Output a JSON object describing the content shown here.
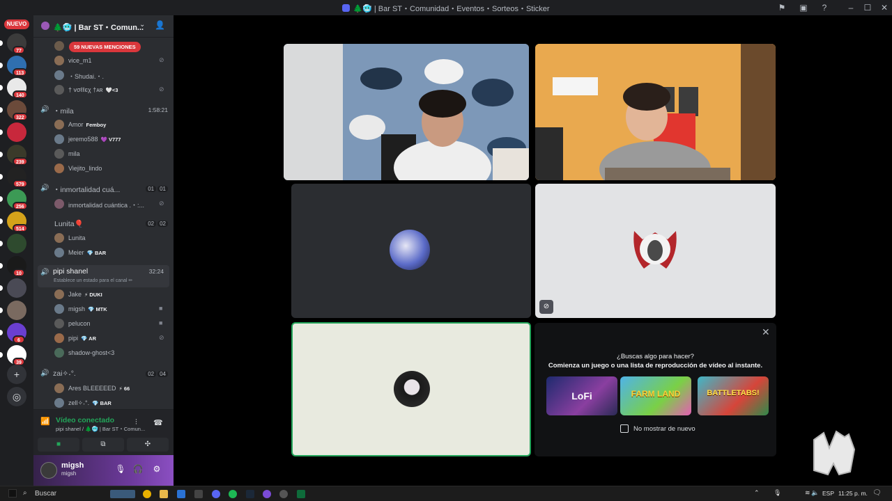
{
  "titlebar": {
    "title": "🌲🥶 | Bar ST・Comunidad・Eventos・Sorteos・Sticker"
  },
  "rail": {
    "new_label": "NUEVO",
    "servers": [
      {
        "badge": "77",
        "color": "#3b3b3b"
      },
      {
        "badge": "113",
        "color": "#2f6fb0"
      },
      {
        "badge": "140",
        "color": "#e9e9e9"
      },
      {
        "badge": "322",
        "color": "#6b4a3a"
      },
      {
        "badge": "",
        "color": "#c8283c"
      },
      {
        "badge": "239",
        "color": "#3a3a2a"
      },
      {
        "badge": "579",
        "color": "#222222"
      },
      {
        "badge": "256",
        "color": "#3c9a55"
      },
      {
        "badge": "514",
        "color": "#d4a21a"
      },
      {
        "badge": "",
        "color": "#2e4a2e"
      },
      {
        "badge": "10",
        "color": "#1a1a1a"
      },
      {
        "badge": "",
        "color": "#4a4a55"
      },
      {
        "badge": "",
        "color": "#7a6a60"
      },
      {
        "badge": "6",
        "color": "#6a3fd0"
      },
      {
        "badge": "39",
        "color": "#ffffff"
      }
    ]
  },
  "guild": {
    "name": "🌲🥶 | Bar ST・Comun..."
  },
  "channels": {
    "mentions_label": "59 NUEVAS MENCIONES",
    "top_members": [
      {
        "name": "vice_m1",
        "tag": ""
      },
      {
        "name": "・Shudai.・.",
        "tag": ""
      },
      {
        "name": "† vσℓℓєχ †ᴀʀ",
        "tag": "🤍<3"
      }
    ],
    "mila": {
      "name": "・mila",
      "time": "1:58:21"
    },
    "mila_members": [
      {
        "name": "Amor",
        "tag": "Femboy"
      },
      {
        "name": "jeremo588",
        "tag": "💜 V777"
      },
      {
        "name": "mila",
        "tag": ""
      },
      {
        "name": "Viejito_lindo",
        "tag": ""
      }
    ],
    "inmortalidad": {
      "name": "・inmortalidad cuá...",
      "a": "01",
      "b": "01"
    },
    "inmortalidad_member": "inmortalidad cuántica .・:...",
    "lunita": {
      "name": "Lunita🎈",
      "a": "02",
      "b": "02"
    },
    "lunita_members": [
      {
        "name": "Lunita",
        "tag": ""
      },
      {
        "name": "Meier",
        "tag": "💎 BAR"
      }
    ],
    "pipi": {
      "name": "pipi shanel",
      "time": "32:24",
      "status": "Establece un estado para el canal ✏"
    },
    "pipi_members": [
      {
        "name": "Jake",
        "tag": "⚡ DUKI"
      },
      {
        "name": "migsh",
        "tag": "💎 MTK"
      },
      {
        "name": "pelucon",
        "tag": ""
      },
      {
        "name": "pipi",
        "tag": "💎 AR"
      },
      {
        "name": "shadow-ghost<3",
        "tag": ""
      }
    ],
    "zai": {
      "name": "zai✧˖°.",
      "a": "02",
      "b": "04"
    },
    "zai_members": [
      {
        "name": "Ares BLEEEEED",
        "tag": "⚡ 66"
      },
      {
        "name": "zell✧˖°.",
        "tag": "💎 BAR"
      }
    ]
  },
  "voice": {
    "status": "Vídeo conectado",
    "sub": "pipi shanel / 🌲🥶 | Bar ST・Comun..."
  },
  "user": {
    "display": "migsh",
    "username": "migsh"
  },
  "activity": {
    "question": "¿Buscas algo para hacer?",
    "sub": "Comienza un juego o una lista de reproducción de vídeo al instante.",
    "games": [
      "LoFi",
      "FARM LAND",
      "BATTLETABS!"
    ],
    "checkbox_label": "No mostrar de nuevo"
  },
  "taskbar": {
    "search": "Buscar",
    "lang": "ESP",
    "time": "11:25 p. m."
  }
}
